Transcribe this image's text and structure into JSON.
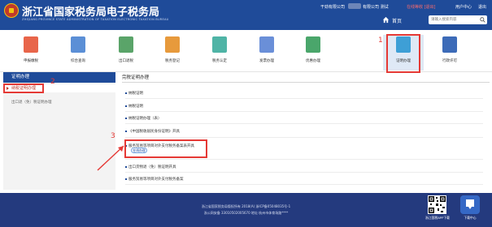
{
  "header": {
    "title": "浙江省国家税务局电子税务局",
    "subtitle": "ZHEJIANG PROVINCE STATE ADMINISTRATION OF TAXATION ELECTRONIC TAXATION BUREAU",
    "user_info_prefix": "干劲有限公司",
    "user_info_mid": "有限公司 测试",
    "exit_link": "在线等收 [退出]",
    "user_center": "用户中心",
    "logout": "退出",
    "home_label": "首页",
    "search_placeholder": "请输入搜索内容"
  },
  "tiles": [
    {
      "label": "申报缴税",
      "color": "#e8654a"
    },
    {
      "label": "综合查询",
      "color": "#5b8fd6"
    },
    {
      "label": "出口退税",
      "color": "#5aa469"
    },
    {
      "label": "税务登记",
      "color": "#e79a3c"
    },
    {
      "label": "税务认定",
      "color": "#4fb4a6"
    },
    {
      "label": "发票办理",
      "color": "#6a8fd8"
    },
    {
      "label": "优惠办理",
      "color": "#4aa66b"
    },
    {
      "label": "证明办理",
      "color": "#3e9fd6"
    },
    {
      "label": "行政许可",
      "color": "#3c6bb8"
    }
  ],
  "annotations": {
    "n1": "1",
    "n2": "2",
    "n3": "3"
  },
  "sidebar": {
    "header": "证明办理",
    "item_active": "纳税证明办理",
    "item_sub": "出口退（免）税证明办理"
  },
  "main": {
    "title": "完税证明办理",
    "rows": [
      "纳税证明",
      "纳税证明",
      "纳税证明办理（表）",
      "《中国税收居民身份证明》开具",
      "服务贸易等项目对外支付税务备案表开具",
      "出口货物退（免）税证明开具",
      "服务贸易等项目对外支付税务备案"
    ],
    "online_button": "在线办理"
  },
  "footer": {
    "line1": "浙江省国家税务局版权所有 2018(A) 浙ICP备05048035号-1",
    "line2": "浙公网安备 33010502005670 地址:杭州市体育场路****",
    "qr_caption": "浙江国税APP下载",
    "app_caption": "下载中心"
  }
}
